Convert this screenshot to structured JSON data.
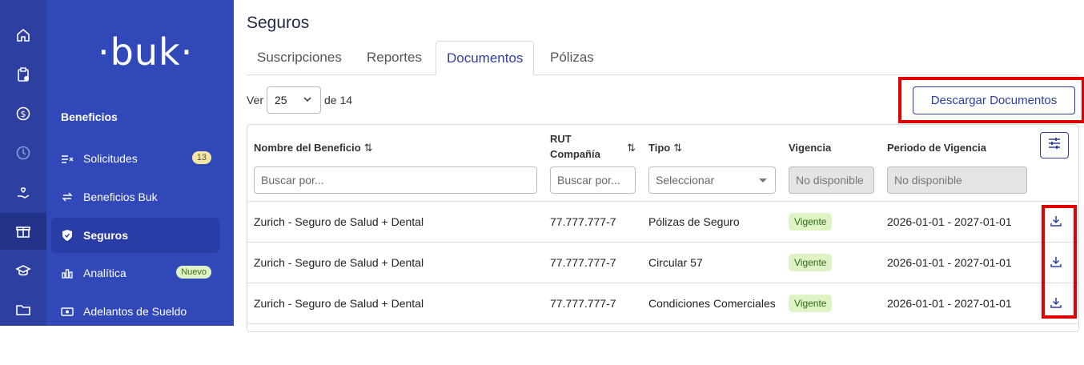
{
  "rail": {
    "icons": [
      "home-icon",
      "clipboard-icon",
      "dollar-icon",
      "clock-icon",
      "hand-heart-icon",
      "gift-icon",
      "graduation-cap-icon",
      "folder-icon"
    ]
  },
  "sidebar": {
    "logo": "·buk·",
    "section_title": "Beneficios",
    "items": [
      {
        "label": "Solicitudes",
        "badge": "13",
        "icon": "list-check-icon"
      },
      {
        "label": "Beneficios Buk",
        "icon": "swap-icon"
      },
      {
        "label": "Seguros",
        "icon": "shield-icon",
        "active": true
      },
      {
        "label": "Analítica",
        "badge": "Nuevo",
        "icon": "chart-icon"
      },
      {
        "label": "Adelantos de Sueldo",
        "icon": "cash-icon"
      }
    ]
  },
  "main": {
    "title": "Seguros",
    "tabs": [
      {
        "label": "Suscripciones"
      },
      {
        "label": "Reportes"
      },
      {
        "label": "Documentos",
        "active": true
      },
      {
        "label": "Pólizas"
      }
    ],
    "pager": {
      "ver": "Ver",
      "page_size": "25",
      "de": "de 14"
    },
    "download_button": "Descargar Documentos",
    "table": {
      "headers": {
        "nombre": "Nombre del Beneficio",
        "rut_1": "RUT",
        "rut_2": "Compañía",
        "tipo": "Tipo",
        "vigencia": "Vigencia",
        "periodo": "Periodo de Vigencia",
        "sort_glyph": "⇅"
      },
      "filters": {
        "nombre_placeholder": "Buscar por...",
        "rut_placeholder": "Buscar por...",
        "tipo_placeholder": "Seleccionar",
        "vigencia_value": "No disponible",
        "periodo_value": "No disponible"
      },
      "rows": [
        {
          "nombre": "Zurich - Seguro de Salud + Dental",
          "rut": "77.777.777-7",
          "tipo": "Pólizas de Seguro",
          "vigencia": "Vigente",
          "periodo": "2026-01-01 - 2027-01-01"
        },
        {
          "nombre": "Zurich - Seguro de Salud + Dental",
          "rut": "77.777.777-7",
          "tipo": "Circular 57",
          "vigencia": "Vigente",
          "periodo": "2026-01-01 - 2027-01-01"
        },
        {
          "nombre": "Zurich - Seguro de Salud + Dental",
          "rut": "77.777.777-7",
          "tipo": "Condiciones Comerciales",
          "vigencia": "Vigente",
          "periodo": "2026-01-01 - 2027-01-01"
        }
      ]
    }
  },
  "colors": {
    "brand": "#3148b8",
    "rail": "#2d3fa0",
    "highlight": "#e00000",
    "vigente_bg": "#dff3c4"
  }
}
